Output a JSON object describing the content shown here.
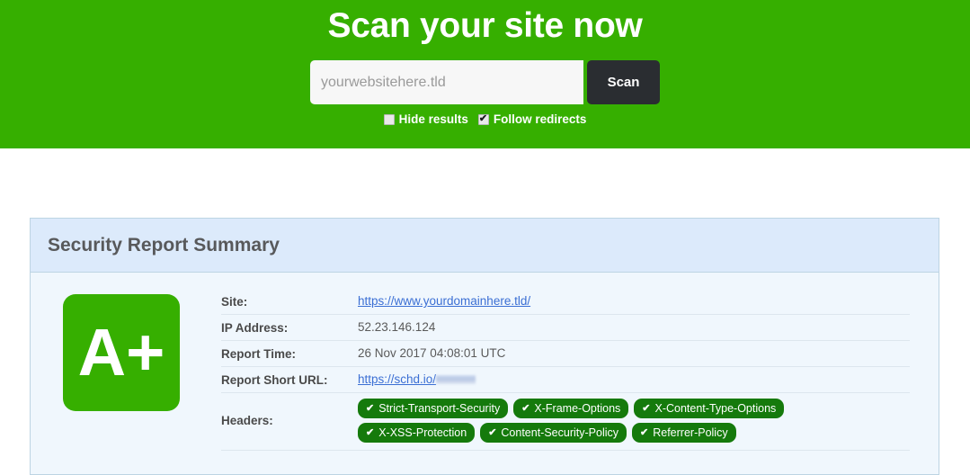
{
  "hero": {
    "title": "Scan your site now",
    "search": {
      "placeholder": "yourwebsitehere.tld",
      "value": "",
      "button_label": "Scan"
    },
    "options": [
      {
        "label": "Hide results",
        "checked": false
      },
      {
        "label": "Follow redirects",
        "checked": true
      }
    ],
    "background_color": "#36af00"
  },
  "report": {
    "header_title": "Security Report Summary",
    "grade": "A+",
    "grade_color": "#36af00",
    "rows": [
      {
        "label": "Site:",
        "value": "https://www.yourdomainhere.tld/",
        "type": "link"
      },
      {
        "label": "IP Address:",
        "value": "52.23.146.124",
        "type": "text"
      },
      {
        "label": "Report Time:",
        "value": "26 Nov 2017 04:08:01 UTC",
        "type": "text"
      },
      {
        "label": "Report Short URL:",
        "value": "https://schd.io/",
        "type": "link-redacted"
      }
    ],
    "headers_label": "Headers:",
    "headers": [
      {
        "name": "Strict-Transport-Security",
        "icon": "check-icon"
      },
      {
        "name": "X-Frame-Options",
        "icon": "check-icon"
      },
      {
        "name": "X-Content-Type-Options",
        "icon": "check-icon"
      },
      {
        "name": "X-XSS-Protection",
        "icon": "check-icon"
      },
      {
        "name": "Content-Security-Policy",
        "icon": "check-icon"
      },
      {
        "name": "Referrer-Policy",
        "icon": "check-icon"
      }
    ],
    "badge_color": "#157a0c",
    "panel_header_color": "#dceafb",
    "panel_body_color": "#f0f7fd"
  }
}
